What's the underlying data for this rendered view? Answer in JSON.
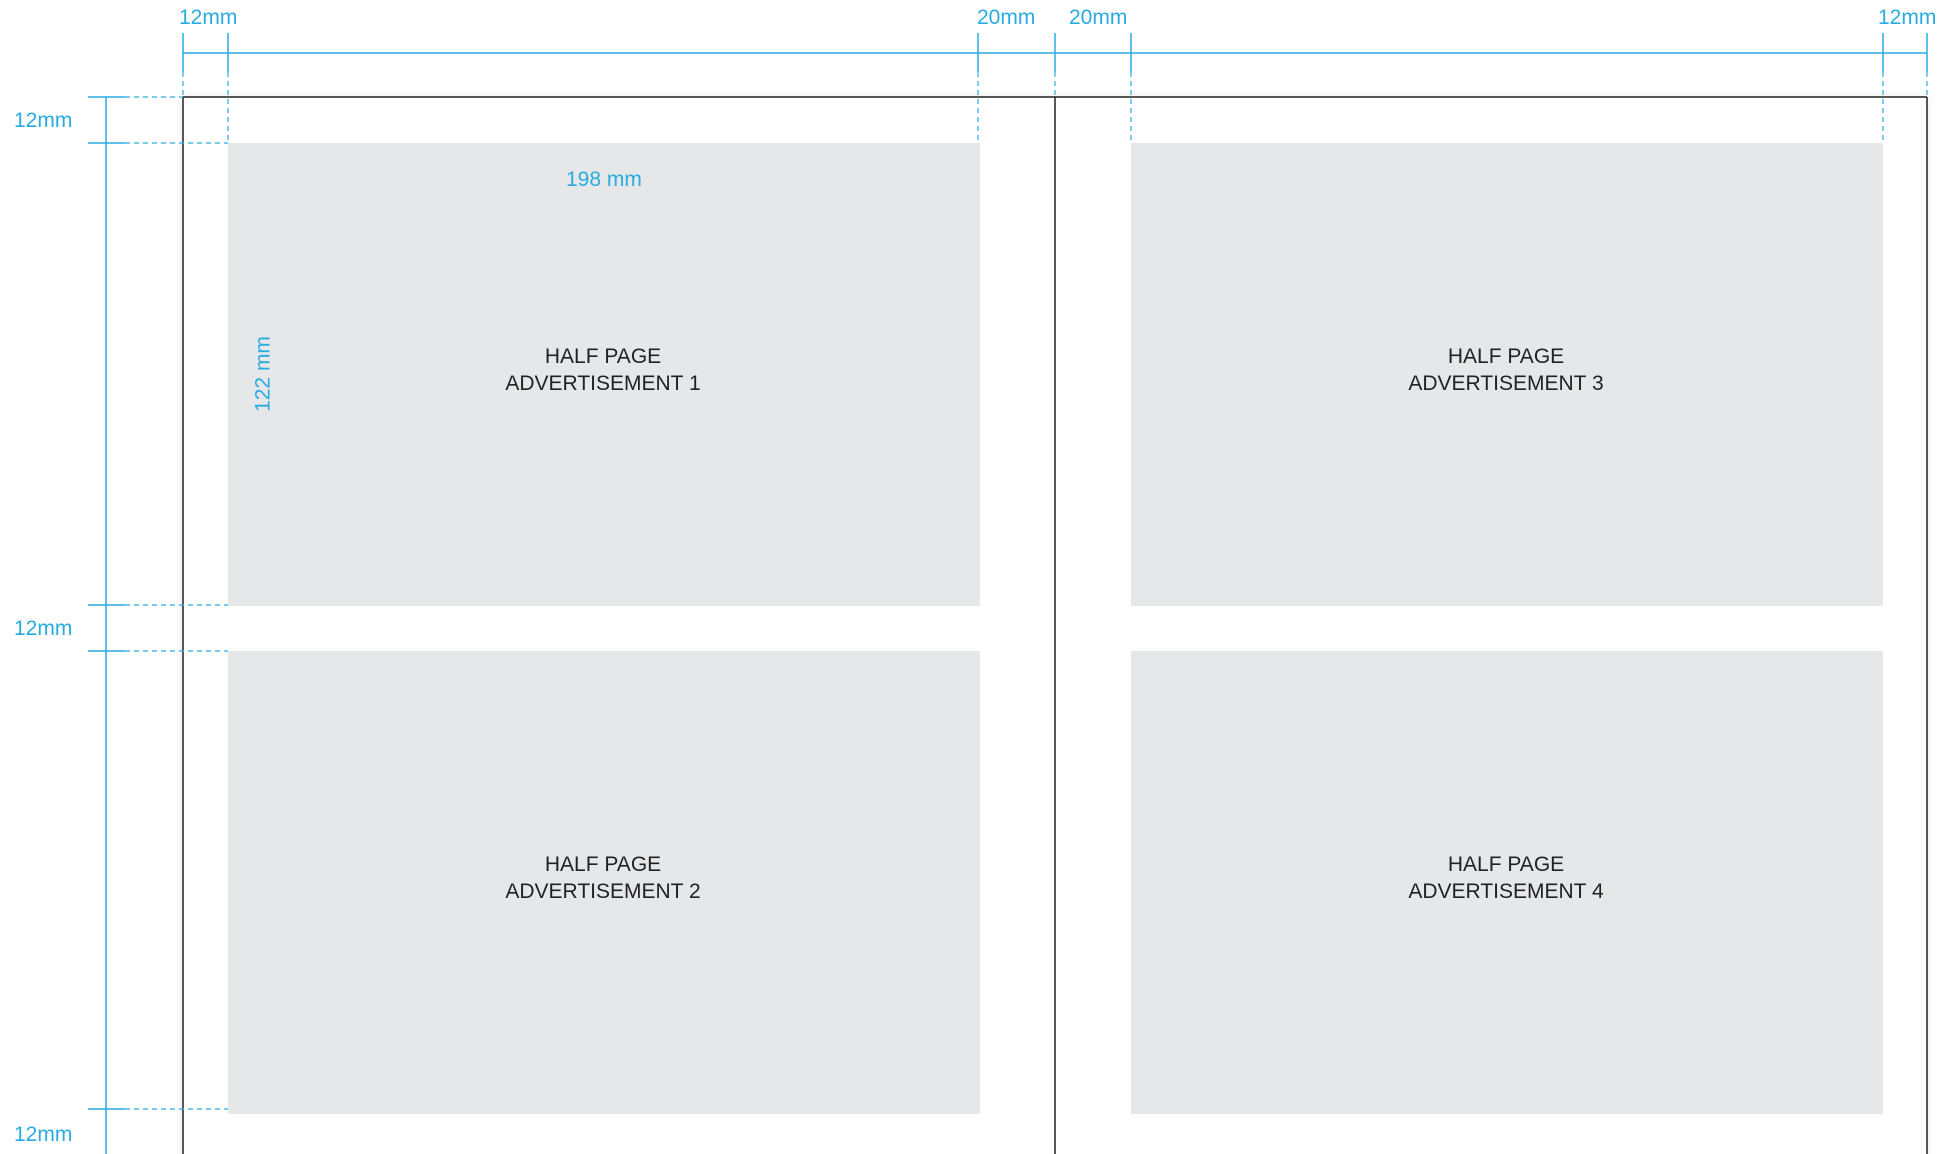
{
  "colors": {
    "guide": "#29ABE2",
    "page_border": "#222222",
    "ad_fill": "#E6E7E9",
    "text": "#222222"
  },
  "top_dimensions": {
    "left_margin": "12mm",
    "gutter_left": "20mm",
    "gutter_right": "20mm",
    "right_margin": "12mm"
  },
  "side_dimensions": {
    "top_margin": "12mm",
    "middle_gap": "12mm",
    "bottom_margin": "12mm"
  },
  "ad_dimensions": {
    "width": "198 mm",
    "height": "122 mm"
  },
  "ads": [
    {
      "line1": "HALF PAGE",
      "line2": "ADVERTISEMENT 1"
    },
    {
      "line1": "HALF PAGE",
      "line2": "ADVERTISEMENT 2"
    },
    {
      "line1": "HALF PAGE",
      "line2": "ADVERTISEMENT 3"
    },
    {
      "line1": "HALF PAGE",
      "line2": "ADVERTISEMENT 4"
    }
  ]
}
